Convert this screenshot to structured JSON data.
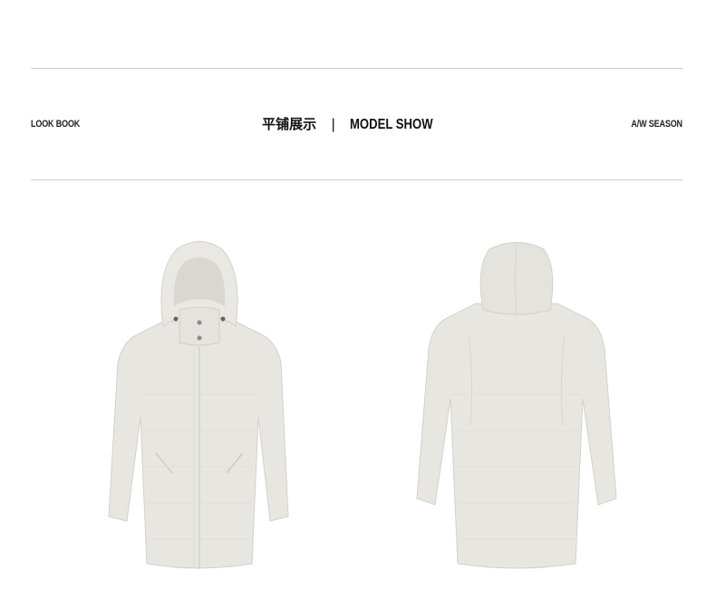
{
  "header": {
    "left_label": "LOOK BOOK",
    "center_cn": "平铺展示",
    "center_separator": "|",
    "center_en": "MODEL SHOW",
    "right_label": "A/W SEASON"
  },
  "photos": {
    "front_label": "front-view-jacket",
    "back_label": "back-view-jacket"
  },
  "colors": {
    "jacket": "#e7e6e1",
    "jacket_shadow": "#d6d5cf",
    "rule": "#cfcfcf",
    "text": "#222222"
  }
}
